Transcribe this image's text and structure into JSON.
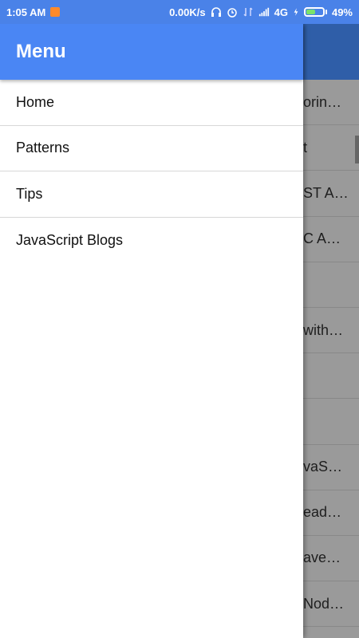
{
  "status_bar": {
    "time": "1:05 AM",
    "network_speed": "0.00K/s",
    "network_type": "4G",
    "battery": "49%",
    "battery_level": 0.49
  },
  "drawer": {
    "title": "Menu",
    "items": [
      {
        "label": "Home"
      },
      {
        "label": "Patterns"
      },
      {
        "label": "Tips"
      },
      {
        "label": "JavaScript Blogs"
      }
    ]
  },
  "background_list": {
    "items": [
      {
        "text": "orin…"
      },
      {
        "text": "t"
      },
      {
        "text": "ST A…"
      },
      {
        "text": "C A…"
      },
      {
        "text": ""
      },
      {
        "text": "with…"
      },
      {
        "text": ""
      },
      {
        "text": ""
      },
      {
        "text": "vaS…"
      },
      {
        "text": "ead…"
      },
      {
        "text": "ave…"
      },
      {
        "text": "Nod…"
      }
    ]
  },
  "colors": {
    "status_bar": "#4a82e8",
    "drawer_header": "#4a86f4",
    "scrim": "#9a9a9a",
    "background_appbar": "#2f5ea8"
  }
}
